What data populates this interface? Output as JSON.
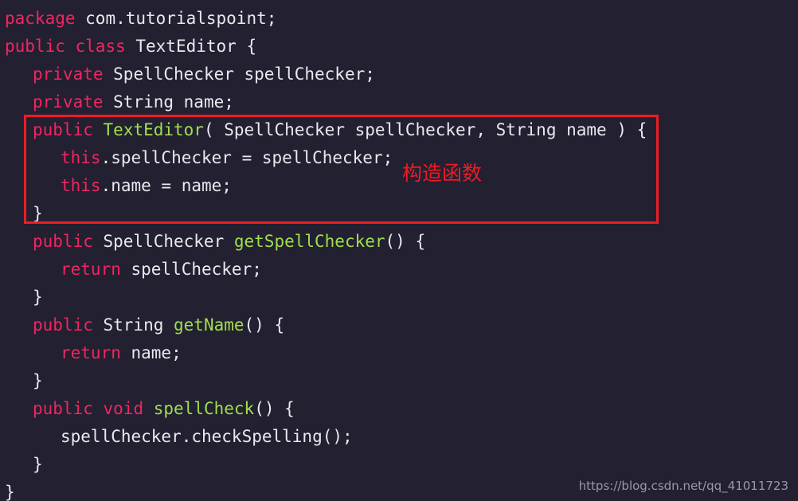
{
  "editor": {
    "language": "java",
    "background_color": "#232031",
    "plain_color": "#e8eaf0",
    "keyword_color": "#f0265f",
    "function_color": "#9fe04a",
    "lines": [
      {
        "indent": 0,
        "tokens": [
          {
            "t": "package",
            "c": "kw"
          },
          {
            "t": " com.tutorialspoint;",
            "c": "pl"
          }
        ]
      },
      {
        "indent": 0,
        "tokens": [
          {
            "t": "public",
            "c": "kw"
          },
          {
            "t": " ",
            "c": "pl"
          },
          {
            "t": "class",
            "c": "kw"
          },
          {
            "t": " TextEditor {",
            "c": "pl"
          }
        ]
      },
      {
        "indent": 1,
        "tokens": [
          {
            "t": "private",
            "c": "kw"
          },
          {
            "t": " SpellChecker spellChecker;",
            "c": "pl"
          }
        ]
      },
      {
        "indent": 1,
        "tokens": [
          {
            "t": "private",
            "c": "kw"
          },
          {
            "t": " String name;",
            "c": "pl"
          }
        ]
      },
      {
        "indent": 1,
        "tokens": [
          {
            "t": "public",
            "c": "kw"
          },
          {
            "t": " ",
            "c": "pl"
          },
          {
            "t": "TextEditor",
            "c": "fn"
          },
          {
            "t": "( SpellChecker spellChecker, String name ) {",
            "c": "pl"
          }
        ]
      },
      {
        "indent": 2,
        "tokens": [
          {
            "t": "this",
            "c": "kw"
          },
          {
            "t": ".spellChecker = spellChecker;",
            "c": "pl"
          }
        ]
      },
      {
        "indent": 2,
        "tokens": [
          {
            "t": "this",
            "c": "kw"
          },
          {
            "t": ".name = name;",
            "c": "pl"
          }
        ]
      },
      {
        "indent": 1,
        "tokens": [
          {
            "t": "}",
            "c": "pl"
          }
        ]
      },
      {
        "indent": 1,
        "tokens": [
          {
            "t": "public",
            "c": "kw"
          },
          {
            "t": " SpellChecker ",
            "c": "pl"
          },
          {
            "t": "getSpellChecker",
            "c": "fn"
          },
          {
            "t": "() {",
            "c": "pl"
          }
        ]
      },
      {
        "indent": 2,
        "tokens": [
          {
            "t": "return",
            "c": "kw"
          },
          {
            "t": " spellChecker;",
            "c": "pl"
          }
        ]
      },
      {
        "indent": 1,
        "tokens": [
          {
            "t": "}",
            "c": "pl"
          }
        ]
      },
      {
        "indent": 1,
        "tokens": [
          {
            "t": "public",
            "c": "kw"
          },
          {
            "t": " String ",
            "c": "pl"
          },
          {
            "t": "getName",
            "c": "fn"
          },
          {
            "t": "() {",
            "c": "pl"
          }
        ]
      },
      {
        "indent": 2,
        "tokens": [
          {
            "t": "return",
            "c": "kw"
          },
          {
            "t": " name;",
            "c": "pl"
          }
        ]
      },
      {
        "indent": 1,
        "tokens": [
          {
            "t": "}",
            "c": "pl"
          }
        ]
      },
      {
        "indent": 1,
        "tokens": [
          {
            "t": "public",
            "c": "kw"
          },
          {
            "t": " ",
            "c": "pl"
          },
          {
            "t": "void",
            "c": "kw"
          },
          {
            "t": " ",
            "c": "pl"
          },
          {
            "t": "spellCheck",
            "c": "fn"
          },
          {
            "t": "() {",
            "c": "pl"
          }
        ]
      },
      {
        "indent": 2,
        "tokens": [
          {
            "t": "spellChecker.checkSpelling();",
            "c": "pl"
          }
        ]
      },
      {
        "indent": 1,
        "tokens": [
          {
            "t": "}",
            "c": "pl"
          }
        ]
      },
      {
        "indent": 0,
        "tokens": [
          {
            "t": "}",
            "c": "pl"
          }
        ]
      }
    ]
  },
  "highlight": {
    "color": "#ee1b24",
    "target_description": "constructor block"
  },
  "annotation": {
    "text": "构造函数",
    "color": "#ee1b24"
  },
  "watermark": {
    "text": "https://blog.csdn.net/qq_41011723",
    "color": "#9a97a8"
  }
}
